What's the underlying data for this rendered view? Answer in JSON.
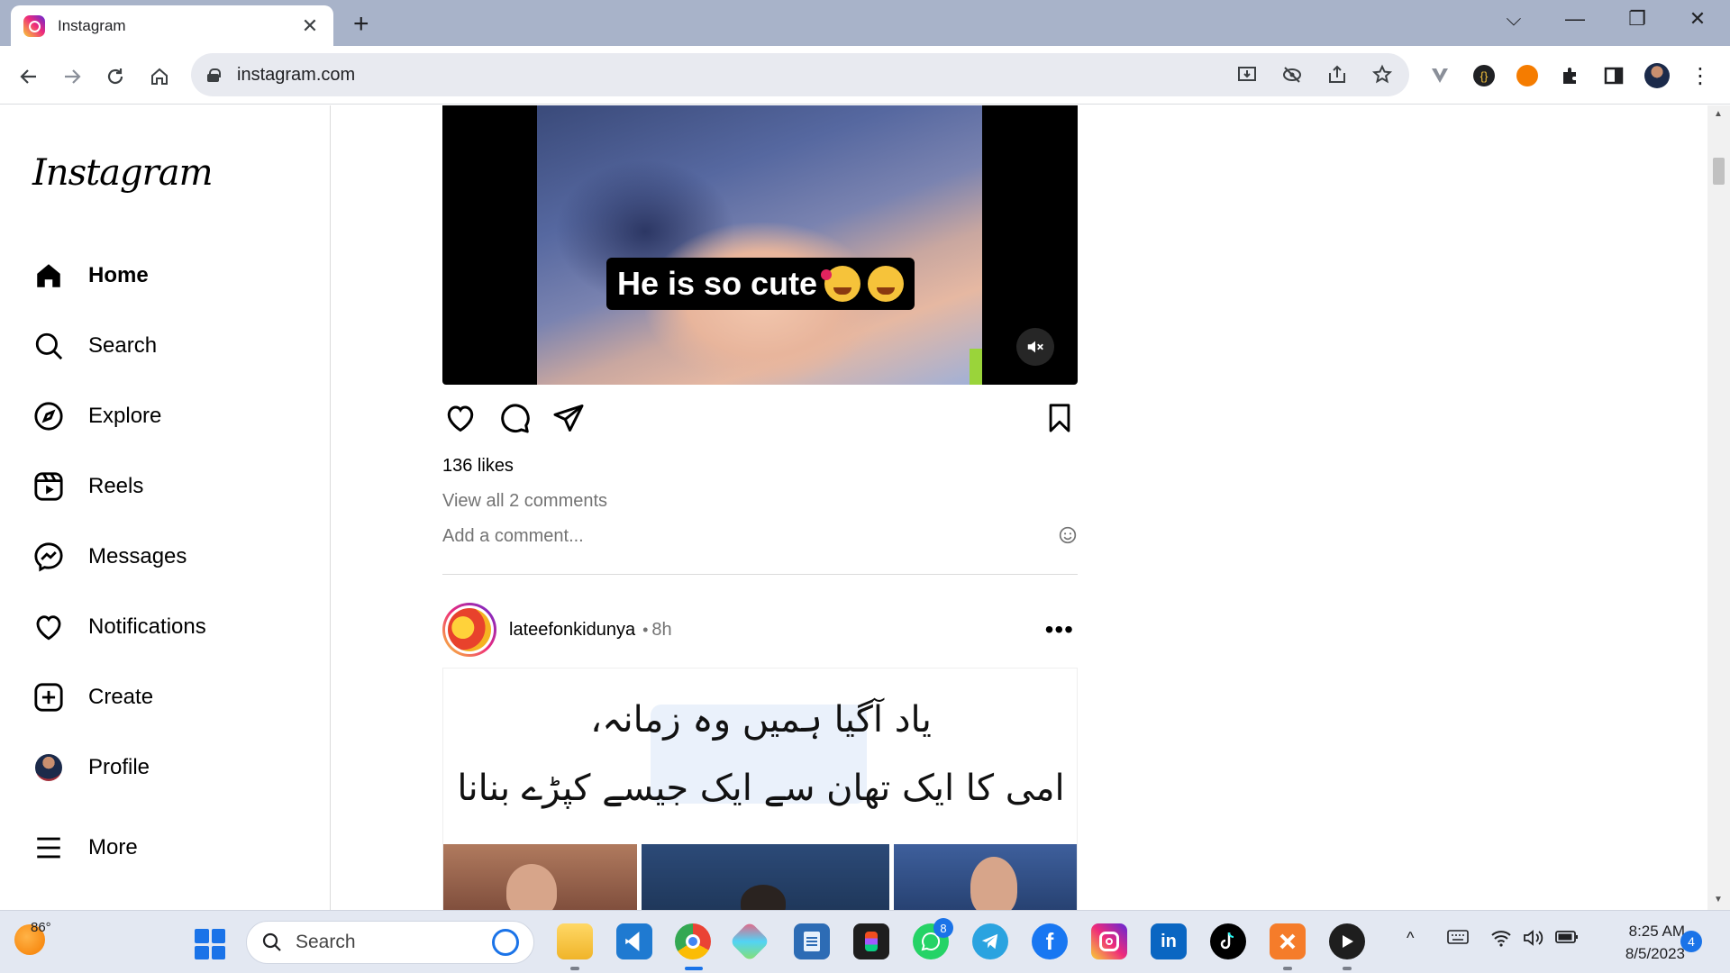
{
  "browser": {
    "tab_title": "Instagram",
    "tab_close": "✕",
    "new_tab": "+",
    "url": "instagram.com",
    "window_controls": {
      "dropdown": "⌵",
      "minimize": "—",
      "restore": "❐",
      "close": "✕"
    }
  },
  "sidebar": {
    "logo": "Instagram",
    "items": [
      {
        "label": "Home",
        "icon": "home-icon",
        "active": true
      },
      {
        "label": "Search",
        "icon": "search-icon"
      },
      {
        "label": "Explore",
        "icon": "compass-icon"
      },
      {
        "label": "Reels",
        "icon": "reels-icon"
      },
      {
        "label": "Messages",
        "icon": "messenger-icon"
      },
      {
        "label": "Notifications",
        "icon": "heart-icon"
      },
      {
        "label": "Create",
        "icon": "plus-square-icon"
      },
      {
        "label": "Profile",
        "icon": "avatar"
      },
      {
        "label": "More",
        "icon": "hamburger-icon"
      }
    ]
  },
  "post1": {
    "caption": "He is so cute",
    "likes": "136 likes",
    "view_comments": "View all 2 comments",
    "add_comment_placeholder": "Add a comment..."
  },
  "post2": {
    "username": "lateefonkidunya",
    "dot": "•",
    "time": "8h",
    "more": "•••",
    "line1": "یاد آگیا ہمیں وہ زمانہ،",
    "line2": "امی کا ایک تھان سے ایک جیسے کپڑے بنانا"
  },
  "taskbar": {
    "temperature": "86°",
    "search_label": "Search",
    "whatsapp_badge": "8",
    "time": "8:25 AM",
    "date": "8/5/2023",
    "notification_count": "4"
  },
  "colors": {
    "tabstrip": "#a8b3c9",
    "instagram_gradient_start": "#f9ce34",
    "instagram_gradient_mid": "#ee2a7b",
    "instagram_gradient_end": "#6228d7",
    "secondary_text": "#737373",
    "windows_blue": "#1a73e8"
  }
}
